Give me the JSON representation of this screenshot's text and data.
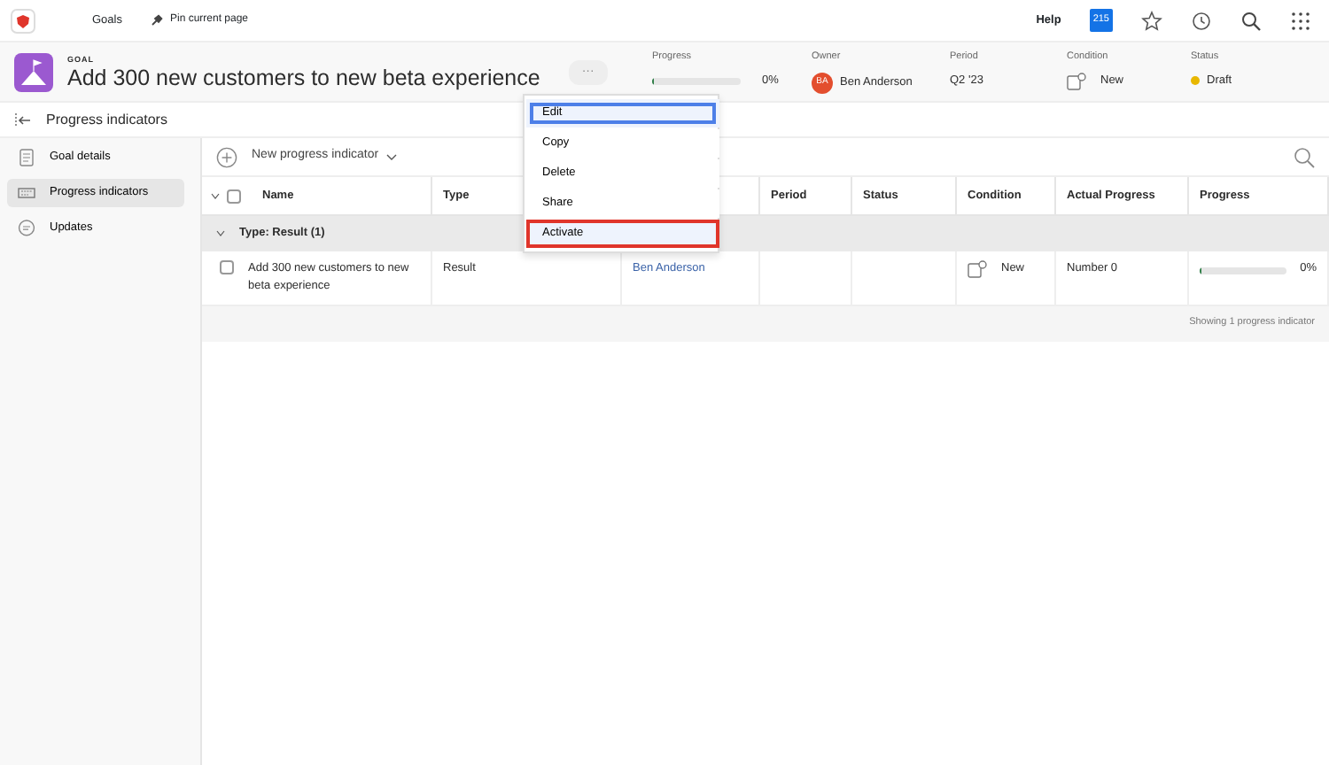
{
  "topnav": {
    "items": [
      "Goals",
      "Pin current page"
    ],
    "help": "Help",
    "badge": "215"
  },
  "header": {
    "eyebrow": "GOAL",
    "title": "Add 300 new customers to new beta experience",
    "more": "···",
    "fields": [
      {
        "kind": "progress",
        "label": "Progress",
        "level": 0,
        "reading": "0%"
      },
      {
        "kind": "owner",
        "label": "Owner",
        "initials": "BA",
        "value": "Ben Anderson"
      },
      {
        "kind": "text",
        "label": "Period",
        "value": "Q2 '23"
      },
      {
        "kind": "condition",
        "label": "Condition",
        "value": "New"
      },
      {
        "kind": "status",
        "label": "Status",
        "value": "Draft",
        "color": "#e8b700"
      }
    ]
  },
  "subheader": {
    "title": "Progress indicators"
  },
  "sidebar": {
    "items": [
      {
        "label": "Goal details",
        "selected": false
      },
      {
        "label": "Progress indicators",
        "selected": true
      },
      {
        "label": "Updates",
        "selected": false
      }
    ]
  },
  "toolbar": {
    "new_button": "New progress indicator"
  },
  "table": {
    "columns": [
      {
        "label": "Name"
      },
      {
        "label": "Type"
      },
      {},
      {
        "label": "Period"
      },
      {
        "label": "Status"
      },
      {
        "label": "Condition"
      },
      {
        "label": "Actual Progress"
      },
      {
        "label": "Progress"
      }
    ],
    "select_all_checked": false,
    "group": "Type: Result (1)",
    "rows": [
      {
        "checked": false,
        "name": "Add 300 new customers to new beta experience",
        "type": "Result",
        "owner": "Ben Anderson",
        "condition": "New",
        "actual": "Number 0",
        "level": 0,
        "reading": "0%"
      }
    ],
    "footer": "Showing 1 progress indicator"
  },
  "menu": [
    {
      "label": "Edit",
      "selected": true,
      "highlighted": false
    },
    {
      "label": "Copy",
      "selected": false,
      "highlighted": false
    },
    {
      "label": "Delete",
      "selected": false,
      "highlighted": false
    },
    {
      "label": "Share",
      "selected": false,
      "highlighted": false
    },
    {
      "label": "Activate",
      "selected": false,
      "highlighted": true
    }
  ]
}
